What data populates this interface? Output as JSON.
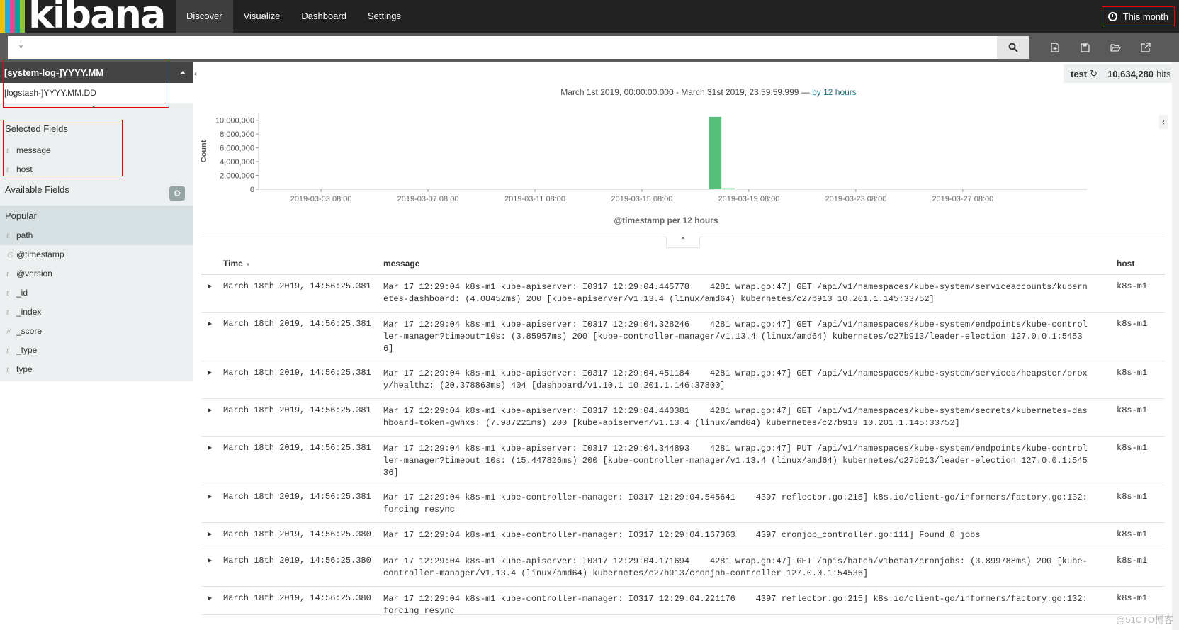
{
  "nav": {
    "logo_text": "kibana",
    "logo_colors": [
      "#f3c300",
      "#27a9e1",
      "#e8478b",
      "#00a69b",
      "#8cc63f"
    ],
    "tabs": [
      {
        "label": "Discover",
        "active": true
      },
      {
        "label": "Visualize",
        "active": false
      },
      {
        "label": "Dashboard",
        "active": false
      },
      {
        "label": "Settings",
        "active": false
      }
    ],
    "timepicker_label": "This month"
  },
  "search": {
    "query": "*",
    "icon": "search-icon"
  },
  "toolbar_icons": [
    "new-search-icon",
    "save-icon",
    "open-icon",
    "share-icon"
  ],
  "sidebar": {
    "index_selected": "[system-log-]YYYY.MM",
    "index_alternate": "[logstash-]YYYY.MM.DD",
    "selected_fields_title": "Selected Fields",
    "selected_fields": [
      {
        "type": "t",
        "name": "message"
      },
      {
        "type": "t",
        "name": "host"
      }
    ],
    "available_fields_title": "Available Fields",
    "popular_title": "Popular",
    "available_fields": [
      {
        "type": "t",
        "name": "path"
      },
      {
        "type": "⊙",
        "name": "@timestamp"
      },
      {
        "type": "t",
        "name": "@version"
      },
      {
        "type": "t",
        "name": "_id"
      },
      {
        "type": "t",
        "name": "_index"
      },
      {
        "type": "#",
        "name": "_score"
      },
      {
        "type": "t",
        "name": "_type"
      },
      {
        "type": "t",
        "name": "type"
      }
    ]
  },
  "hits": {
    "index_name": "test",
    "count": "10,634,280",
    "label": "hits"
  },
  "timerange": {
    "text": "March 1st 2019, 00:00:00.000 - March 31st 2019, 23:59:59.999 —",
    "interval_link": "by 12 hours"
  },
  "chart_data": {
    "type": "bar",
    "ylabel": "Count",
    "xlabel": "@timestamp per 12 hours",
    "ylim": [
      0,
      11000000
    ],
    "yticks": [
      0,
      2000000,
      4000000,
      6000000,
      8000000,
      10000000
    ],
    "ytick_labels": [
      "0",
      "2,000,000",
      "4,000,000",
      "6,000,000",
      "8,000,000",
      "10,000,000"
    ],
    "xticks": [
      "2019-03-03 08:00",
      "2019-03-07 08:00",
      "2019-03-11 08:00",
      "2019-03-15 08:00",
      "2019-03-19 08:00",
      "2019-03-23 08:00",
      "2019-03-27 08:00"
    ],
    "series": [
      {
        "values": [
          {
            "x": "2019-03-17 20:00",
            "y": 10500000
          },
          {
            "x": "2019-03-18 08:00",
            "y": 134280
          }
        ]
      }
    ],
    "bar_color": "#57c17b",
    "grid": false
  },
  "table": {
    "headers": {
      "time": "Time",
      "message": "message",
      "host": "host"
    },
    "rows": [
      {
        "time": "March 18th 2019, 14:56:25.381",
        "message": "Mar 17 12:29:04 k8s-m1 kube-apiserver: I0317 12:29:04.445778    4281 wrap.go:47] GET /api/v1/namespaces/kube-system/serviceaccounts/kubernetes-dashboard: (4.08452ms) 200 [kube-apiserver/v1.13.4 (linux/amd64) kubernetes/c27b913 10.201.1.145:33752]",
        "host": "k8s-m1"
      },
      {
        "time": "March 18th 2019, 14:56:25.381",
        "message": "Mar 17 12:29:04 k8s-m1 kube-apiserver: I0317 12:29:04.328246    4281 wrap.go:47] GET /api/v1/namespaces/kube-system/endpoints/kube-controller-manager?timeout=10s: (3.85957ms) 200 [kube-controller-manager/v1.13.4 (linux/amd64) kubernetes/c27b913/leader-election 127.0.0.1:54536]",
        "host": "k8s-m1"
      },
      {
        "time": "March 18th 2019, 14:56:25.381",
        "message": "Mar 17 12:29:04 k8s-m1 kube-apiserver: I0317 12:29:04.451184    4281 wrap.go:47] GET /api/v1/namespaces/kube-system/services/heapster/proxy/healthz: (20.378863ms) 404 [dashboard/v1.10.1 10.201.1.146:37800]",
        "host": "k8s-m1"
      },
      {
        "time": "March 18th 2019, 14:56:25.381",
        "message": "Mar 17 12:29:04 k8s-m1 kube-apiserver: I0317 12:29:04.440381    4281 wrap.go:47] GET /api/v1/namespaces/kube-system/secrets/kubernetes-dashboard-token-gwhxs: (7.987221ms) 200 [kube-apiserver/v1.13.4 (linux/amd64) kubernetes/c27b913 10.201.1.145:33752]",
        "host": "k8s-m1"
      },
      {
        "time": "March 18th 2019, 14:56:25.381",
        "message": "Mar 17 12:29:04 k8s-m1 kube-apiserver: I0317 12:29:04.344893    4281 wrap.go:47] PUT /api/v1/namespaces/kube-system/endpoints/kube-controller-manager?timeout=10s: (15.447826ms) 200 [kube-controller-manager/v1.13.4 (linux/amd64) kubernetes/c27b913/leader-election 127.0.0.1:54536]",
        "host": "k8s-m1"
      },
      {
        "time": "March 18th 2019, 14:56:25.381",
        "message": "Mar 17 12:29:04 k8s-m1 kube-controller-manager: I0317 12:29:04.545641    4397 reflector.go:215] k8s.io/client-go/informers/factory.go:132: forcing resync",
        "host": "k8s-m1"
      },
      {
        "time": "March 18th 2019, 14:56:25.380",
        "message": "Mar 17 12:29:04 k8s-m1 kube-controller-manager: I0317 12:29:04.167363    4397 cronjob_controller.go:111] Found 0 jobs",
        "host": "k8s-m1"
      },
      {
        "time": "March 18th 2019, 14:56:25.380",
        "message": "Mar 17 12:29:04 k8s-m1 kube-apiserver: I0317 12:29:04.171694    4281 wrap.go:47] GET /apis/batch/v1beta1/cronjobs: (3.899788ms) 200 [kube-controller-manager/v1.13.4 (linux/amd64) kubernetes/c27b913/cronjob-controller 127.0.0.1:54536]",
        "host": "k8s-m1"
      },
      {
        "time": "March 18th 2019, 14:56:25.380",
        "message": "Mar 17 12:29:04 k8s-m1 kube-controller-manager: I0317 12:29:04.221176    4397 reflector.go:215] k8s.io/client-go/informers/factory.go:132: forcing resync",
        "host": "k8s-m1"
      }
    ]
  },
  "watermark": "@51CTO博客"
}
